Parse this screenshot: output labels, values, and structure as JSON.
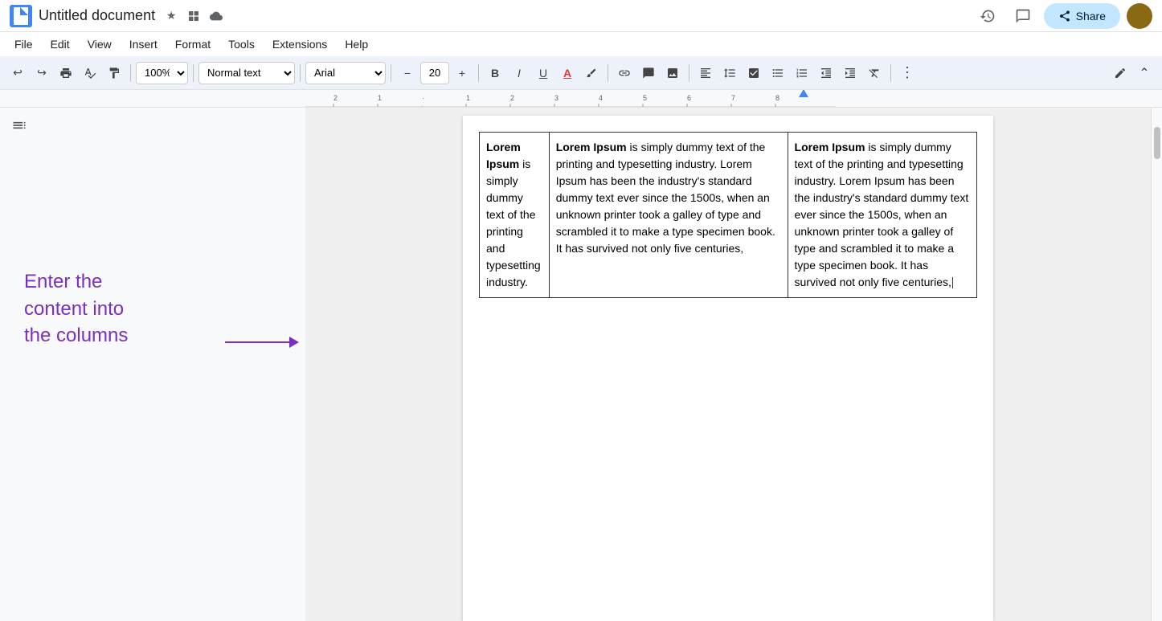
{
  "titleBar": {
    "appName": "Untitled document",
    "starLabel": "★",
    "driveLabel": "⊡",
    "cloudLabel": "☁",
    "historyLabel": "↺",
    "commentLabel": "💬",
    "shareLabel": "Share",
    "pencilLabel": "✏"
  },
  "menu": {
    "items": [
      "File",
      "Edit",
      "View",
      "Insert",
      "Format",
      "Tools",
      "Extensions",
      "Help"
    ]
  },
  "toolbar": {
    "undoLabel": "↩",
    "redoLabel": "↪",
    "printLabel": "🖨",
    "spellLabel": "✓",
    "paintLabel": "🖍",
    "zoomValue": "100%",
    "styleValue": "Normal text",
    "fontValue": "Arial",
    "fontSizeValue": "20",
    "decreaseLabel": "−",
    "increaseLabel": "+",
    "boldLabel": "B",
    "italicLabel": "I",
    "underlineLabel": "U",
    "colorLabel": "A",
    "highlightLabel": "✏",
    "linkLabel": "🔗",
    "commentLabel": "💬",
    "imageLabel": "🖼",
    "alignLabel": "≡",
    "spacingLabel": "↕",
    "listLabel": "☰",
    "numberedLabel": "≔",
    "indentDecLabel": "⇤",
    "indentIncLabel": "⇥",
    "clearLabel": "✕",
    "moreLabel": "⋮"
  },
  "annotation": {
    "line1": "Enter the",
    "line2": "content into",
    "line3": "the columns"
  },
  "columns": {
    "col1": {
      "textBold": "Lorem Ipsum",
      "textNormal": " is simply dummy text of the printing and typesetting industry."
    },
    "col2": {
      "textBold": "Lorem Ipsum",
      "textNormal": " is simply dummy text of the printing and typesetting industry. Lorem Ipsum has been the industry's standard dummy text ever since the 1500s, when an unknown printer took a galley of type and scrambled it to make a type specimen book. It has survived not only five centuries,"
    },
    "col3": {
      "textBold": "Lorem Ipsum",
      "textNormal": " is simply dummy text of the printing and typesetting industry. Lorem Ipsum has been the industry's standard dummy text ever since the 1500s, when an unknown printer took a galley of type and scrambled it to make a type specimen book. It has survived not only five centuries,"
    }
  }
}
